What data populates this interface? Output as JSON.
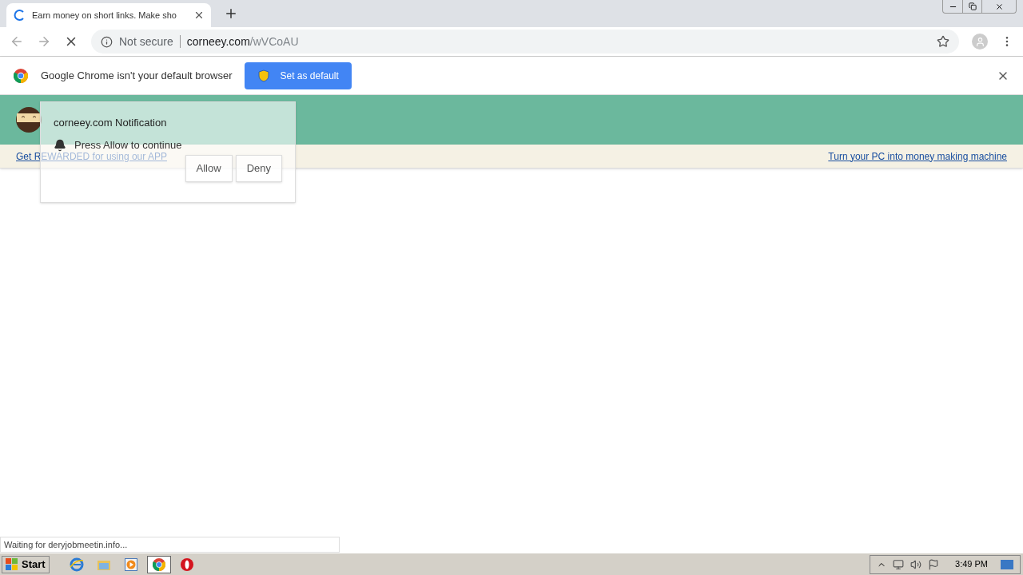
{
  "browser": {
    "tab": {
      "title": "Earn money on short links. Make sho",
      "loading": true
    },
    "address": {
      "security": "Not secure",
      "host": "corneey.com",
      "path": "/wVCoAU"
    }
  },
  "infobar": {
    "message": "Google Chrome isn't your default browser",
    "button": "Set as default"
  },
  "site": {
    "links": [
      "Get REWARDED for using our APP",
      "Turn your PC into money making machine"
    ]
  },
  "notification": {
    "title": "corneey.com Notification",
    "message": "Press Allow to continue",
    "buttons": [
      "Allow",
      "Deny"
    ]
  },
  "status": "Waiting for deryjobmeetin.info...",
  "taskbar": {
    "start": "Start",
    "apps": [
      {
        "kind": "ie",
        "selected": false
      },
      {
        "kind": "folder",
        "selected": false
      },
      {
        "kind": "media",
        "selected": false
      },
      {
        "kind": "chrome",
        "selected": true
      },
      {
        "kind": "opera",
        "selected": false
      }
    ],
    "clock": "3:49 PM"
  }
}
